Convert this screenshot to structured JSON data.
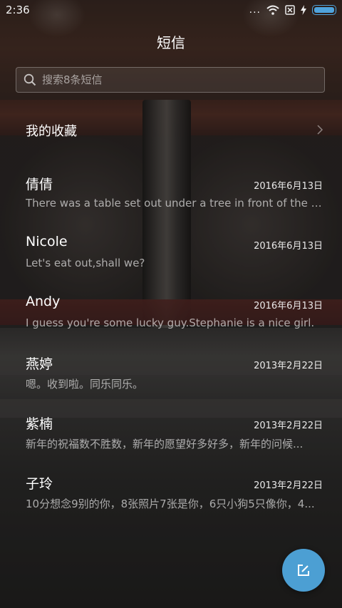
{
  "status_bar": {
    "time": "2:36",
    "more_dots": "...",
    "battery_color": "#4fa3dc"
  },
  "header": {
    "title": "短信"
  },
  "search": {
    "placeholder": "搜索8条短信"
  },
  "favorites": {
    "label": "我的收藏"
  },
  "threads": [
    {
      "name": "倩倩",
      "date": "2016年6月13日",
      "preview": "There was a table set out under a tree in front of the ho..."
    },
    {
      "name": "Nicole",
      "date": "2016年6月13日",
      "preview": "Let's eat out,shall we?"
    },
    {
      "name": "Andy",
      "date": "2016年6月13日",
      "preview": "I guess you're some lucky guy.Stephanie is a nice girl."
    },
    {
      "name": "燕婷",
      "date": "2013年2月22日",
      "preview": "嗯。收到啦。同乐同乐。"
    },
    {
      "name": "紫楠",
      "date": "2013年2月22日",
      "preview": "新年的祝福数不胜数，新年的愿望好多好多，新年的问候..."
    },
    {
      "name": "子玲",
      "date": "2013年2月22日",
      "preview": "10分想念9别的你，8张照片7张是你，6只小狗5只像你，4..."
    }
  ],
  "fab": {
    "icon": "compose-icon",
    "color": "#4c9fd3"
  }
}
